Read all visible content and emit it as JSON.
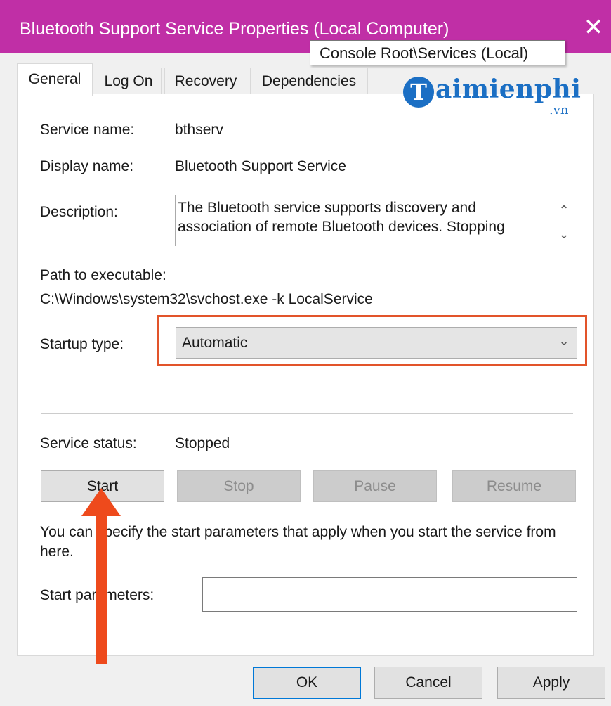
{
  "window": {
    "title": "Bluetooth Support Service Properties (Local Computer)",
    "close_glyph": "✕",
    "title_bar_color": "#c02fa6"
  },
  "tooltip": {
    "text": "Console Root\\Services (Local)"
  },
  "tabs": [
    {
      "label": "General",
      "active": true
    },
    {
      "label": "Log On",
      "active": false
    },
    {
      "label": "Recovery",
      "active": false
    },
    {
      "label": "Dependencies",
      "active": false
    }
  ],
  "watermark": {
    "initial": "T",
    "text": "aimienphi",
    "suffix": ".vn",
    "color": "#1b6fc4"
  },
  "general": {
    "service_name_label": "Service name:",
    "service_name_value": "bthserv",
    "display_name_label": "Display name:",
    "display_name_value": "Bluetooth Support Service",
    "description_label": "Description:",
    "description_value": "The Bluetooth service supports discovery and association of remote Bluetooth devices.  Stopping",
    "path_label": "Path to executable:",
    "path_value": "C:\\Windows\\system32\\svchost.exe -k LocalService",
    "startup_type_label": "Startup type:",
    "startup_type_value": "Automatic",
    "highlight_color": "#e2542a",
    "service_status_label": "Service status:",
    "service_status_value": "Stopped",
    "buttons": {
      "start": "Start",
      "stop": "Stop",
      "pause": "Pause",
      "resume": "Resume"
    },
    "hint_text": "You can specify the start parameters that apply when you start the service from here.",
    "start_parameters_label": "Start parameters:",
    "start_parameters_value": ""
  },
  "footer": {
    "ok": "OK",
    "cancel": "Cancel",
    "apply": "Apply"
  },
  "annotation_arrow_color": "#ee4a1c"
}
